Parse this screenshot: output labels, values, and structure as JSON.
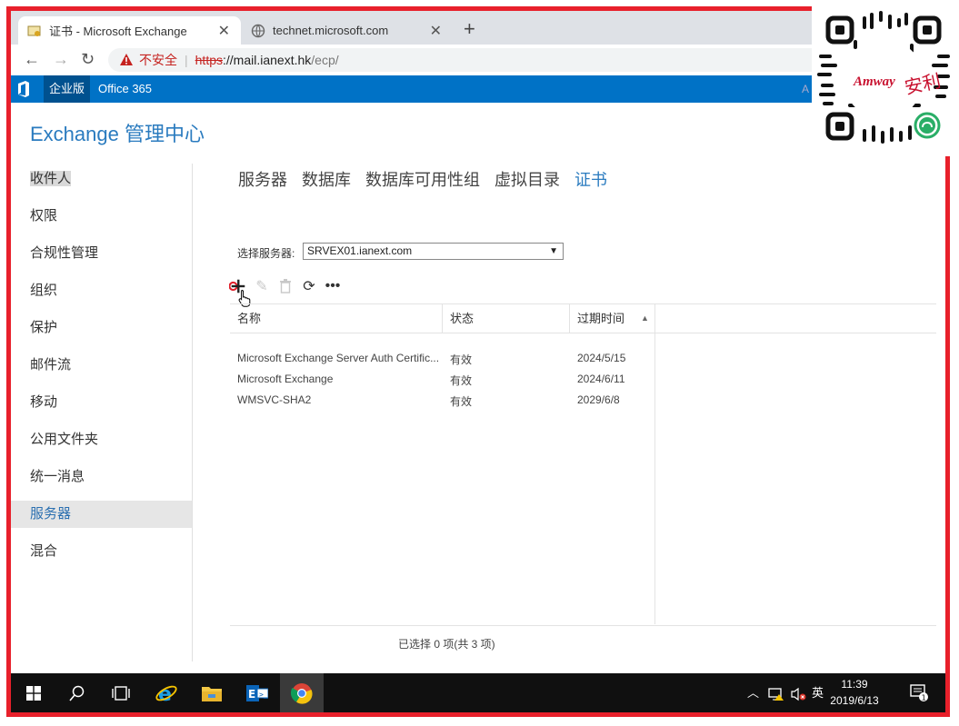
{
  "browser": {
    "tabs": [
      {
        "title": "证书 - Microsoft Exchange",
        "active": true
      },
      {
        "title": "technet.microsoft.com",
        "active": false
      }
    ],
    "new_tab": "+",
    "security_label": "不安全",
    "url_scheme": "https",
    "url_host": "://mail.ianext.hk",
    "url_path": "/ecp/"
  },
  "suite": {
    "enterprise": "企业版",
    "product": "Office 365",
    "user_initial": "A"
  },
  "app_title": "Exchange 管理中心",
  "nav": {
    "items": [
      "收件人",
      "权限",
      "合规性管理",
      "组织",
      "保护",
      "邮件流",
      "移动",
      "公用文件夹",
      "统一消息",
      "服务器",
      "混合"
    ],
    "selected": "服务器"
  },
  "subtabs": [
    "服务器",
    "数据库",
    "数据库可用性组",
    "虚拟目录",
    "证书"
  ],
  "active_subtab": "证书",
  "server_select": {
    "label": "选择服务器:",
    "value": "SRVEX01.ianext.com"
  },
  "grid": {
    "columns": [
      "名称",
      "状态",
      "过期时间"
    ],
    "rows": [
      {
        "name": "Microsoft Exchange Server Auth Certific...",
        "status": "有效",
        "expires": "2024/5/15"
      },
      {
        "name": "Microsoft Exchange",
        "status": "有效",
        "expires": "2024/6/11"
      },
      {
        "name": "WMSVC-SHA2",
        "status": "有效",
        "expires": "2029/6/8"
      }
    ],
    "status_text": "已选择 0 项(共 3 项)"
  },
  "taskbar": {
    "time": "11:39",
    "date": "2019/6/13",
    "ime": "英",
    "notification_count": "1"
  },
  "overlay": {
    "brand": "Amway",
    "brand_cn": "安利"
  },
  "colors": {
    "accent": "#0072c6",
    "title_blue": "#2a7bbf",
    "frame_red": "#e8202b"
  }
}
